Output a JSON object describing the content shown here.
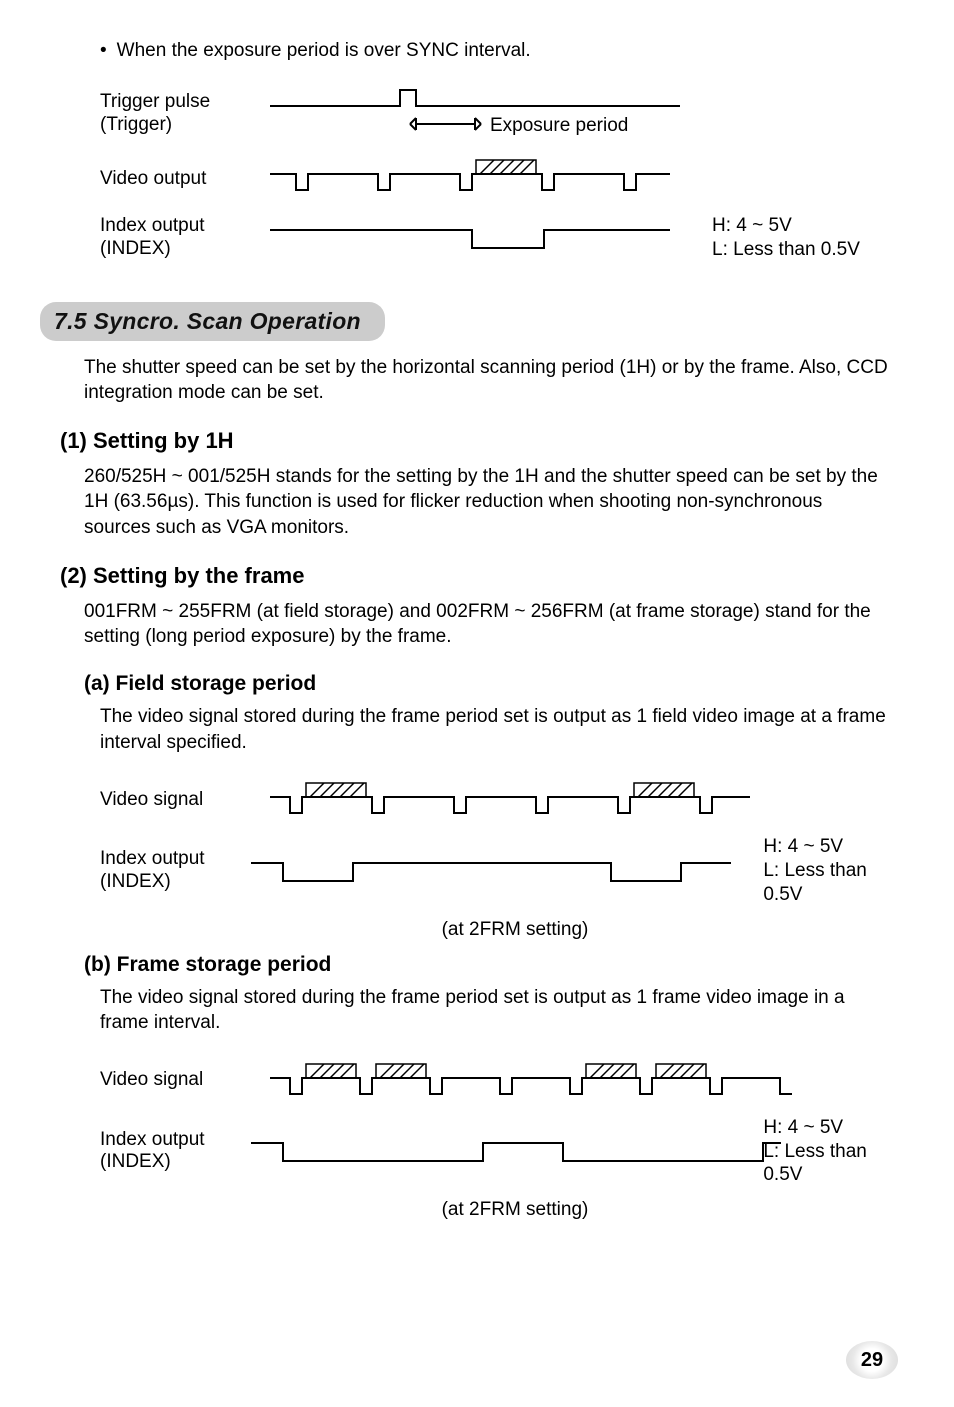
{
  "bullet_top": "When the exposure period is over SYNC interval.",
  "dia1": {
    "trigger_label": "Trigger pulse\n(Trigger)",
    "exposure_label": "Exposure period",
    "video_label": "Video output",
    "index_label": "Index output\n(INDEX)",
    "levels": "H: 4 ~ 5V\nL: Less than 0.5V"
  },
  "section_7_5": "7.5 Syncro. Scan Operation",
  "para_7_5_intro": "The shutter speed can be set by the horizontal scanning period (1H) or by the frame. Also, CCD integration mode can be set.",
  "sub1_1": "(1) Setting by 1H",
  "para_1h": "260/525H ~ 001/525H stands for the setting by the 1H and the shutter speed can be set by the 1H (63.56µs). This function is used for flicker reduction when shooting non-synchronous sources such as VGA monitors.",
  "sub1_2": "(2) Setting by the frame",
  "para_frame_intro": "001FRM ~ 255FRM (at field storage) and 002FRM ~ 256FRM (at frame storage) stand for the setting (long period exposure) by the frame.",
  "sub2_a": "(a)  Field storage period",
  "para_a": "The video signal stored during the frame period set is output as 1 field video image at a frame interval specified.",
  "dia2": {
    "video_label": "Video signal",
    "index_label": "Index output\n(INDEX)",
    "note": "(at 2FRM setting)",
    "levels": "H: 4 ~ 5V\nL: Less than 0.5V"
  },
  "sub2_b": "(b)  Frame storage period",
  "para_b": "The video signal stored during the frame period set is output as 1 frame video image in a frame interval.",
  "dia3": {
    "video_label": "Video signal",
    "index_label": "Index output\n(INDEX)",
    "note": "(at 2FRM setting)",
    "levels": "H: 4 ~ 5V\nL: Less than 0.5V"
  },
  "page_number": "29"
}
